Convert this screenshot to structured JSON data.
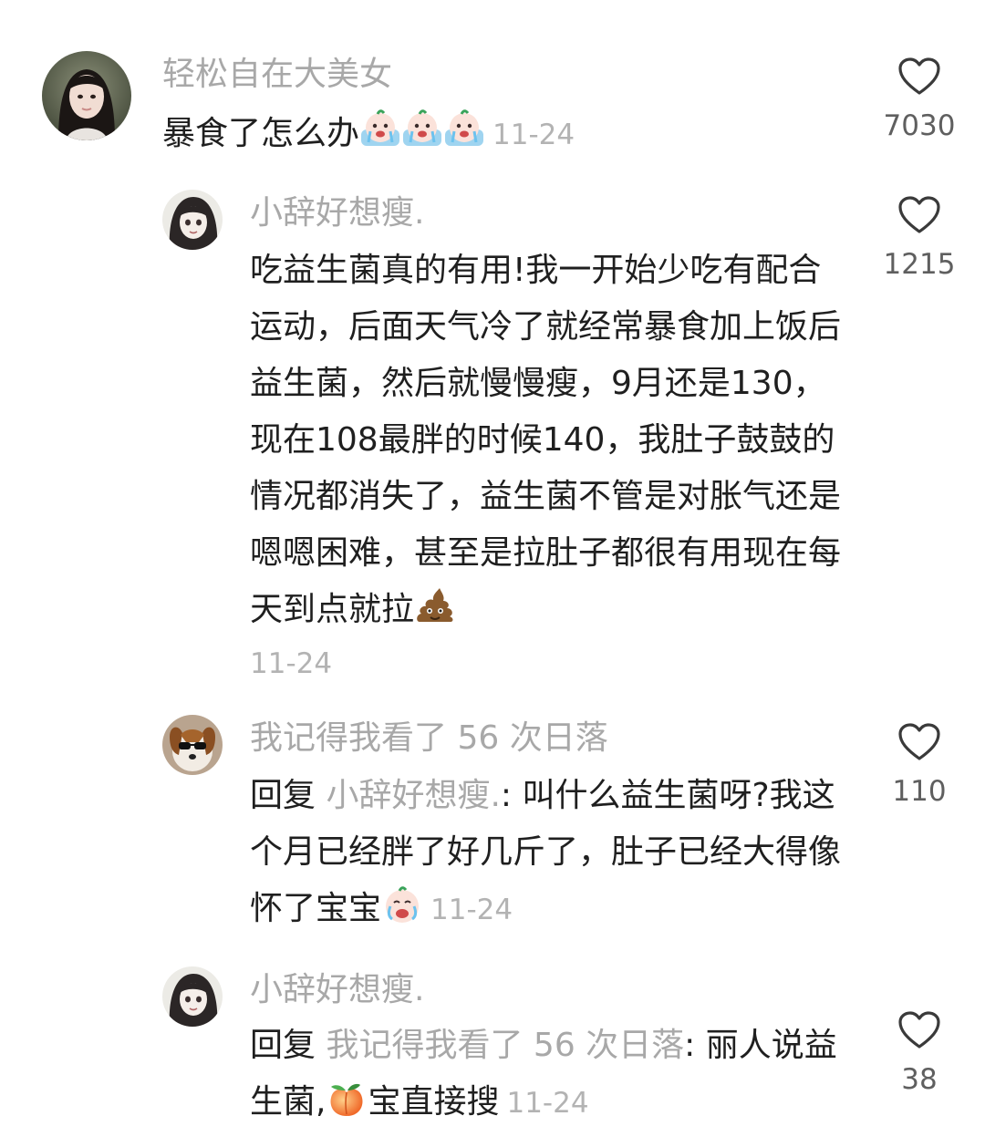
{
  "comments": [
    {
      "username": "轻松自在大美女",
      "text": "暴食了怎么办",
      "date": "11-24",
      "likes": "7030",
      "avatar": "photo-avatar-girl",
      "emoji": [
        "crying-peach-emoji",
        "crying-peach-emoji",
        "crying-peach-emoji"
      ]
    },
    {
      "username": "小辞好想瘦.",
      "text": "吃益生菌真的有用!我一开始少吃有配合运动，后面天气冷了就经常暴食加上饭后益生菌，然后就慢慢瘦，9月还是130，现在108最胖的时候140，我肚子鼓鼓的情况都消失了，益生菌不管是对胀气还是嗯嗯困难，甚至是拉肚子都很有用现在每天到点就拉",
      "date": "11-24",
      "likes": "1215",
      "avatar": "anime-avatar-girl",
      "emoji": [
        "poop-emoji"
      ]
    },
    {
      "username": "我记得我看了 56 次日落",
      "reply_prefix": "回复",
      "reply_target": "小辞好想瘦.",
      "reply_sep": ":",
      "text": "叫什么益生菌呀?我这个月已经胖了好几斤了，肚子已经大得像怀了宝宝",
      "date": "11-24",
      "likes": "110",
      "avatar": "dog-avatar",
      "emoji": [
        "crying-peach-emoji"
      ]
    },
    {
      "username": "小辞好想瘦.",
      "reply_prefix": "回复",
      "reply_target": "我记得我看了 56 次日落",
      "reply_sep": ":",
      "text_before": "丽人说益生菌,",
      "text_after": "宝直接搜",
      "date": "11-24",
      "likes": "38",
      "avatar": "anime-avatar-girl",
      "emoji": [
        "peach-emoji"
      ]
    }
  ],
  "colors": {
    "username": "#a8a8a8",
    "text": "#1f1f1f",
    "date": "#b3b3b3",
    "like_count": "#5f5f5f",
    "heart_outline": "#3a3a3a"
  }
}
